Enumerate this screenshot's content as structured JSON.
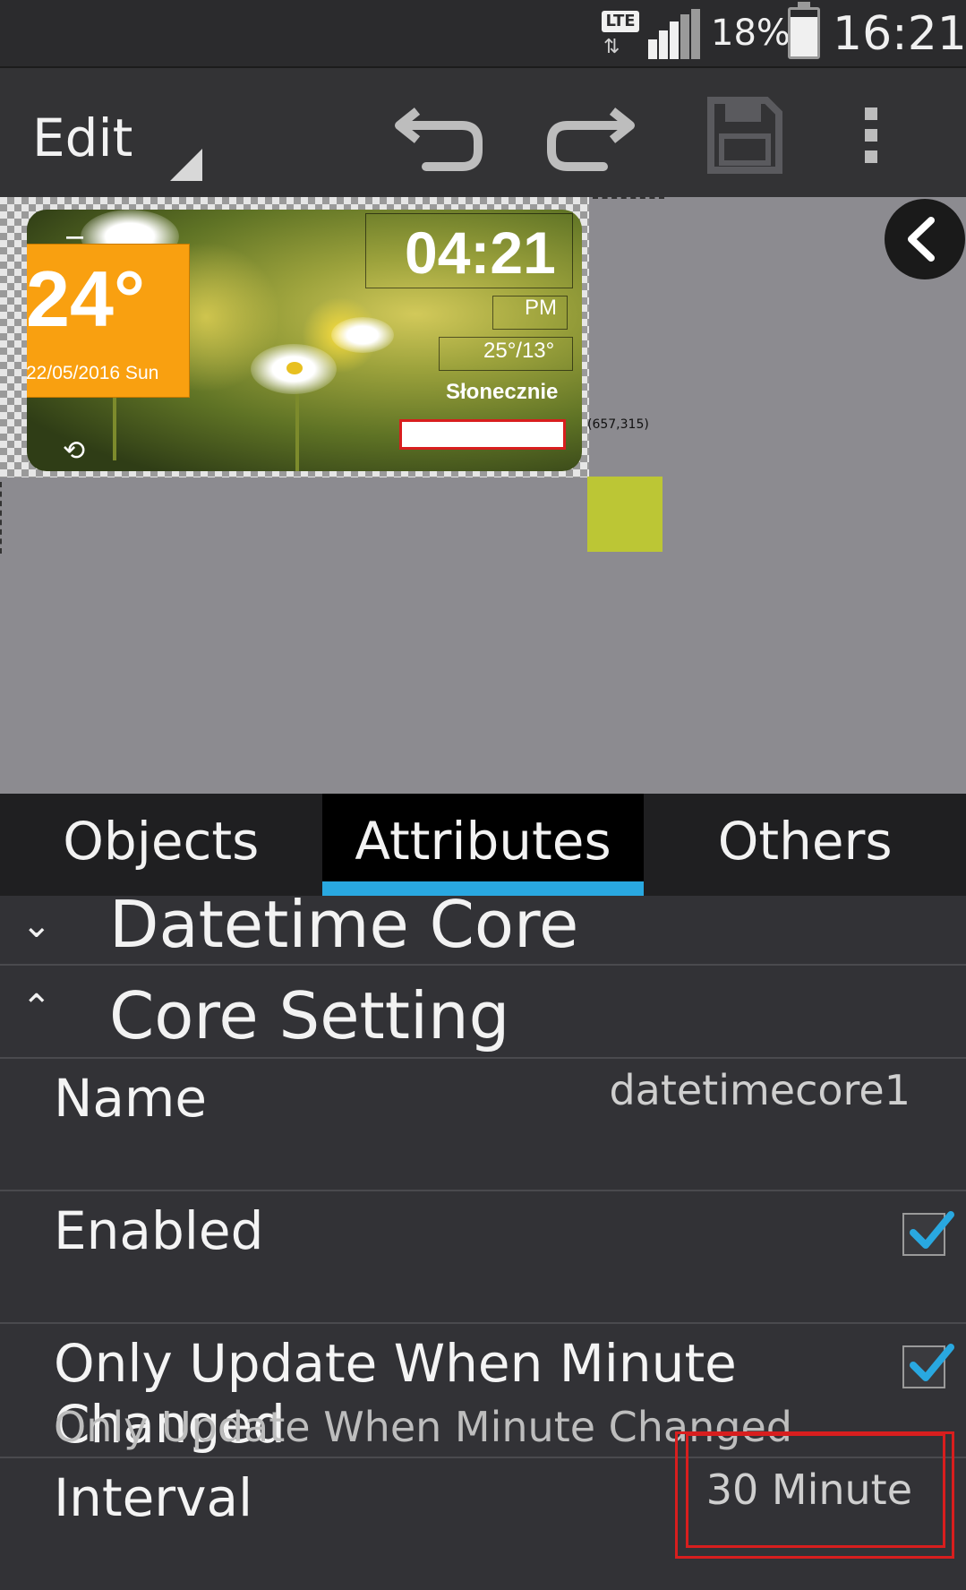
{
  "status_bar": {
    "network": "LTE",
    "battery": "18%",
    "time": "16:21"
  },
  "toolbar": {
    "title": "Edit",
    "icons": [
      "undo-icon",
      "redo-icon",
      "save-icon",
      "more-vert-icon"
    ]
  },
  "widget": {
    "temperature": "24°",
    "date": "22/05/2016 Sun",
    "time": "04:21",
    "ampm": "PM",
    "hilo": "25°/13°",
    "condition": "Słonecznie"
  },
  "canvas": {
    "coords": "(657,315)"
  },
  "tabs": [
    {
      "label": "Objects",
      "active": false
    },
    {
      "label": "Attributes",
      "active": true
    },
    {
      "label": "Others",
      "active": false
    }
  ],
  "properties": {
    "section1": "Datetime Core",
    "section2": "Core Setting",
    "name_label": "Name",
    "name_value": "datetimecore1",
    "enabled_label": "Enabled",
    "enabled_checked": true,
    "only_update_label": "Only Update When Minute Changed",
    "only_update_sub": "Only Update When Minute Changed",
    "only_update_checked": true,
    "interval_label": "Interval",
    "interval_value": "30 Minute"
  },
  "colors": {
    "accent": "#29a8e0",
    "highlight": "#d81e1e",
    "widget_orange": "#f9a010"
  }
}
